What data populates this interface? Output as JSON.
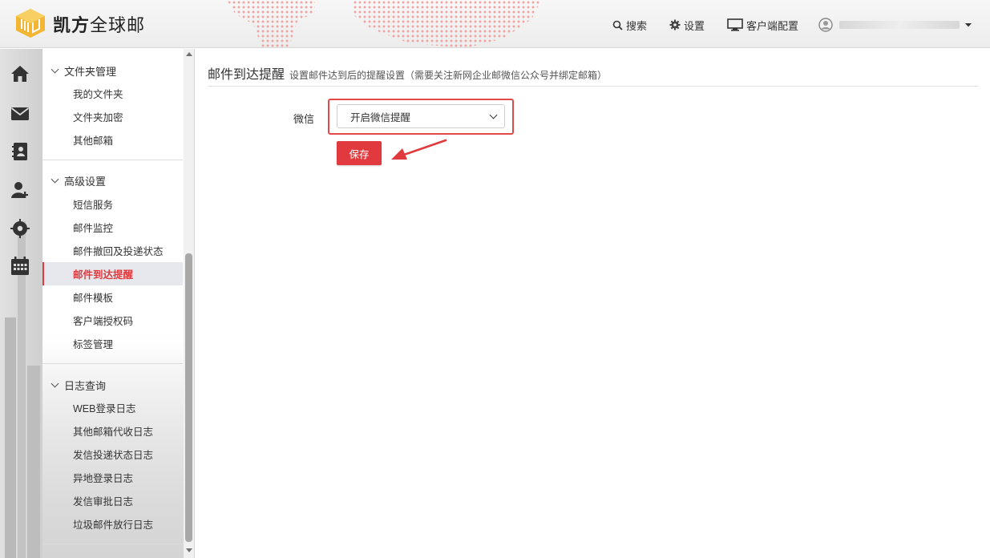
{
  "app": {
    "brand_bold": "凯方",
    "brand_rest": "全球邮"
  },
  "header": {
    "search_label": "搜索",
    "settings_label": "设置",
    "client_config_label": "客户端配置"
  },
  "iconbar": [
    "home-icon",
    "mail-icon",
    "contacts-icon",
    "add-user-icon",
    "compass-icon",
    "calendar-icon"
  ],
  "sidebar": {
    "groups": [
      {
        "label": "文件夹管理",
        "items": [
          "我的文件夹",
          "文件夹加密",
          "其他邮箱"
        ]
      },
      {
        "label": "高级设置",
        "items": [
          "短信服务",
          "邮件监控",
          "邮件撤回及投递状态",
          "邮件到达提醒",
          "邮件模板",
          "客户端授权码",
          "标签管理"
        ]
      },
      {
        "label": "日志查询",
        "items": [
          "WEB登录日志",
          "其他邮箱代收日志",
          "发信投递状态日志",
          "异地登录日志",
          "发信审批日志",
          "垃圾邮件放行日志"
        ]
      }
    ],
    "active_item": "邮件到达提醒"
  },
  "main": {
    "title": "邮件到达提醒",
    "subtitle": "设置邮件达到后的提醒设置（需要关注新网企业邮微信公众号并绑定邮箱）",
    "wechat_label": "微信",
    "wechat_select_value": "开启微信提醒",
    "save_label": "保存"
  },
  "colors": {
    "accent": "#e03a3e",
    "highlight_border": "#e24a4a"
  }
}
